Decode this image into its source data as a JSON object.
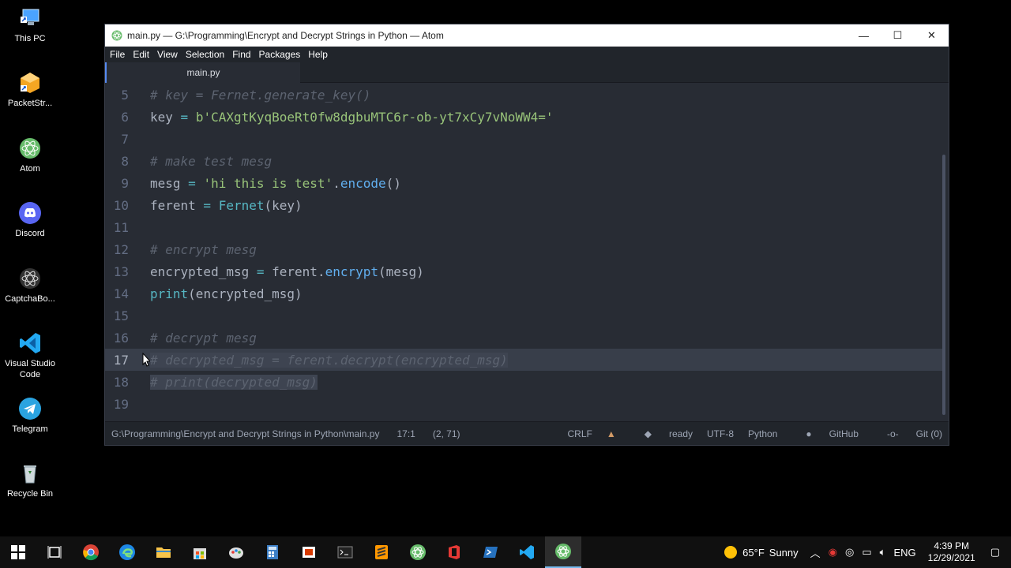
{
  "desktop": {
    "icons": [
      {
        "label": "This PC",
        "icon": "computer-icon"
      },
      {
        "label": "PacketStr...",
        "icon": "packet-icon"
      },
      {
        "label": "Atom",
        "icon": "atom-icon"
      },
      {
        "label": "Discord",
        "icon": "discord-icon"
      },
      {
        "label": "CaptchaBo...",
        "icon": "captcha-icon"
      },
      {
        "label": "Visual Studio Code",
        "icon": "vscode-icon"
      },
      {
        "label": "Telegram",
        "icon": "telegram-icon"
      },
      {
        "label": "Recycle Bin",
        "icon": "recycle-bin-icon"
      }
    ]
  },
  "window": {
    "title": "main.py — G:\\Programming\\Encrypt and Decrypt Strings in Python — Atom",
    "controls": {
      "minimize": "—",
      "maximize": "☐",
      "close": "✕"
    }
  },
  "menu": [
    "File",
    "Edit",
    "View",
    "Selection",
    "Find",
    "Packages",
    "Help"
  ],
  "tab": {
    "label": "main.py"
  },
  "editor": {
    "lines": [
      {
        "num": "5"
      },
      {
        "num": "6"
      },
      {
        "num": "7"
      },
      {
        "num": "8"
      },
      {
        "num": "9"
      },
      {
        "num": "10"
      },
      {
        "num": "11"
      },
      {
        "num": "12"
      },
      {
        "num": "13"
      },
      {
        "num": "14"
      },
      {
        "num": "15"
      },
      {
        "num": "16"
      },
      {
        "num": "17"
      },
      {
        "num": "18"
      },
      {
        "num": "19"
      }
    ],
    "code": {
      "l5": "# key = Fernet.generate_key()",
      "l6_var": "key",
      "l6_eq": " = ",
      "l6_str": "b'CAXgtKyqBoeRt0fw8dgbuMTC6r-ob-yt7xCy7vNoWW4='",
      "l8": "# make test mesg",
      "l9_var": "mesg",
      "l9_eq": " = ",
      "l9_str": "'hi this is test'",
      "l9_dot": ".",
      "l9_fn": "encode",
      "l9_paren": "()",
      "l10_var": "ferent",
      "l10_eq": " = ",
      "l10_cls": "Fernet",
      "l10_args": "(key)",
      "l12": "# encrypt mesg",
      "l13_var": "encrypted_msg",
      "l13_eq": " = ",
      "l13_obj": "ferent.",
      "l13_fn": "encrypt",
      "l13_args": "(mesg)",
      "l14_fn": "print",
      "l14_args": "(encrypted_msg)",
      "l16": "# decrypt mesg",
      "l17": "# decrypted_msg = ferent.decrypt(encrypted_msg)",
      "l18": "# print(decrypted_msg)"
    }
  },
  "status": {
    "path": "G:\\Programming\\Encrypt and Decrypt Strings in Python\\main.py",
    "cursor": "17:1",
    "selection": "(2, 71)",
    "line_ending": "CRLF",
    "state": "ready",
    "encoding": "UTF-8",
    "grammar": "Python",
    "github": "GitHub",
    "git": "Git (0)"
  },
  "taskbar": {
    "weather_temp": "65°F",
    "weather_text": "Sunny",
    "lang": "ENG",
    "time": "4:39 PM",
    "date": "12/29/2021"
  }
}
